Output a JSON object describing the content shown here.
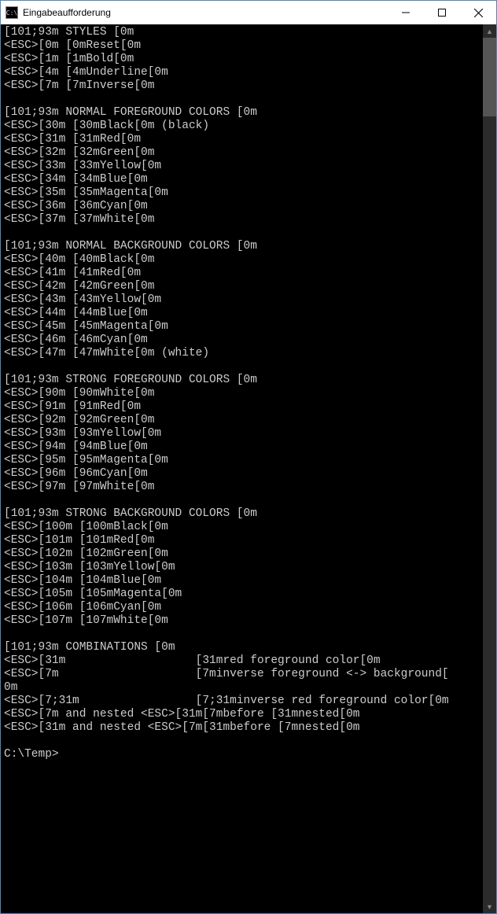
{
  "window": {
    "title": "Eingabeaufforderung"
  },
  "sections": {
    "styles": {
      "header_pre": "[101;93m",
      "header_txt": " STYLES ",
      "header_post": "[0m",
      "rows": [
        {
          "c1": "<ESC>[0m",
          "c2": "[0mReset[0m"
        },
        {
          "c1": "<ESC>[1m",
          "c2": "[1mBold[0m"
        },
        {
          "c1": "<ESC>[4m",
          "c2": "[4mUnderline[0m"
        },
        {
          "c1": "<ESC>[7m",
          "c2": "[7mInverse[0m"
        }
      ]
    },
    "nfg": {
      "header_pre": "[101;93m",
      "header_txt": " NORMAL FOREGROUND COLORS ",
      "header_post": "[0m",
      "rows": [
        {
          "c1": "<ESC>[30m",
          "c2": "[30mBlack[0m (black)"
        },
        {
          "c1": "<ESC>[31m",
          "c2": "[31mRed[0m"
        },
        {
          "c1": "<ESC>[32m",
          "c2": "[32mGreen[0m"
        },
        {
          "c1": "<ESC>[33m",
          "c2": "[33mYellow[0m"
        },
        {
          "c1": "<ESC>[34m",
          "c2": "[34mBlue[0m"
        },
        {
          "c1": "<ESC>[35m",
          "c2": "[35mMagenta[0m"
        },
        {
          "c1": "<ESC>[36m",
          "c2": "[36mCyan[0m"
        },
        {
          "c1": "<ESC>[37m",
          "c2": "[37mWhite[0m"
        }
      ]
    },
    "nbg": {
      "header_pre": "[101;93m",
      "header_txt": " NORMAL BACKGROUND COLORS ",
      "header_post": "[0m",
      "rows": [
        {
          "c1": "<ESC>[40m",
          "c2": "[40mBlack[0m"
        },
        {
          "c1": "<ESC>[41m",
          "c2": "[41mRed[0m"
        },
        {
          "c1": "<ESC>[42m",
          "c2": "[42mGreen[0m"
        },
        {
          "c1": "<ESC>[43m",
          "c2": "[43mYellow[0m"
        },
        {
          "c1": "<ESC>[44m",
          "c2": "[44mBlue[0m"
        },
        {
          "c1": "<ESC>[45m",
          "c2": "[45mMagenta[0m"
        },
        {
          "c1": "<ESC>[46m",
          "c2": "[46mCyan[0m"
        },
        {
          "c1": "<ESC>[47m",
          "c2": "[47mWhite[0m (white)"
        }
      ]
    },
    "sfg": {
      "header_pre": "[101;93m",
      "header_txt": " STRONG FOREGROUND COLORS ",
      "header_post": "[0m",
      "rows": [
        {
          "c1": "<ESC>[90m",
          "c2": "[90mWhite[0m"
        },
        {
          "c1": "<ESC>[91m",
          "c2": "[91mRed[0m"
        },
        {
          "c1": "<ESC>[92m",
          "c2": "[92mGreen[0m"
        },
        {
          "c1": "<ESC>[93m",
          "c2": "[93mYellow[0m"
        },
        {
          "c1": "<ESC>[94m",
          "c2": "[94mBlue[0m"
        },
        {
          "c1": "<ESC>[95m",
          "c2": "[95mMagenta[0m"
        },
        {
          "c1": "<ESC>[96m",
          "c2": "[96mCyan[0m"
        },
        {
          "c1": "<ESC>[97m",
          "c2": "[97mWhite[0m"
        }
      ]
    },
    "sbg": {
      "header_pre": "[101;93m",
      "header_txt": " STRONG BACKGROUND COLORS ",
      "header_post": "[0m",
      "rows": [
        {
          "c1": "<ESC>[100m",
          "c2": "[100mBlack[0m"
        },
        {
          "c1": "<ESC>[101m",
          "c2": "[101mRed[0m"
        },
        {
          "c1": "<ESC>[102m",
          "c2": "[102mGreen[0m"
        },
        {
          "c1": "<ESC>[103m",
          "c2": "[103mYellow[0m"
        },
        {
          "c1": "<ESC>[104m",
          "c2": "[104mBlue[0m"
        },
        {
          "c1": "<ESC>[105m",
          "c2": "[105mMagenta[0m"
        },
        {
          "c1": "<ESC>[106m",
          "c2": "[106mCyan[0m"
        },
        {
          "c1": "<ESC>[107m",
          "c2": "[107mWhite[0m"
        }
      ]
    },
    "combo": {
      "header_pre": "[101;93m",
      "header_txt": " COMBINATIONS ",
      "header_post": "[0m",
      "rows": [
        {
          "c1": "<ESC>[31m",
          "c2": "[31mred foreground color[0m"
        },
        {
          "c1": "<ESC>[7m",
          "c2": "[7minverse foreground <-> background[0m",
          "wrap": true
        },
        {
          "c1": "<ESC>[7;31m",
          "c2": "[7;31minverse red foreground color[0m"
        },
        {
          "c1": "<ESC>[7m and nested <ESC>[31m",
          "c2": "[7mbefore [31mnested[0m"
        },
        {
          "c1": "<ESC>[31m and nested <ESC>[7m",
          "c2": "[31mbefore [7mnested[0m"
        }
      ]
    }
  },
  "prompt": "C:\\Temp>"
}
